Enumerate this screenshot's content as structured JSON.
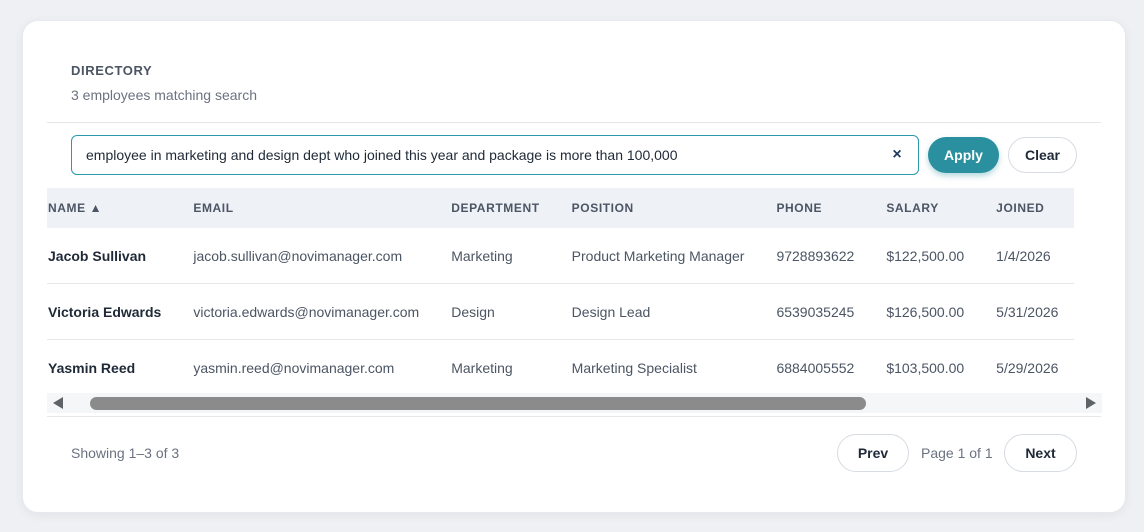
{
  "header": {
    "title": "DIRECTORY",
    "subtitle": "3 employees matching search"
  },
  "search": {
    "value": "employee in marketing and design dept who joined this year and package is more than 100,000",
    "clear_icon": "×",
    "apply_label": "Apply",
    "clear_label": "Clear"
  },
  "table": {
    "columns": [
      "NAME ▲",
      "EMAIL",
      "DEPARTMENT",
      "POSITION",
      "PHONE",
      "SALARY",
      "JOINED"
    ],
    "rows": [
      {
        "name": "Jacob Sullivan",
        "email": "jacob.sullivan@novimanager.com",
        "department": "Marketing",
        "position": "Product Marketing Manager",
        "phone": "9728893622",
        "salary": "$122,500.00",
        "joined": "1/4/2026"
      },
      {
        "name": "Victoria Edwards",
        "email": "victoria.edwards@novimanager.com",
        "department": "Design",
        "position": "Design Lead",
        "phone": "6539035245",
        "salary": "$126,500.00",
        "joined": "5/31/2026"
      },
      {
        "name": "Yasmin Reed",
        "email": "yasmin.reed@novimanager.com",
        "department": "Marketing",
        "position": "Marketing Specialist",
        "phone": "6884005552",
        "salary": "$103,500.00",
        "joined": "5/29/2026"
      }
    ]
  },
  "footer": {
    "showing": "Showing 1–3 of 3",
    "prev_label": "Prev",
    "page_info": "Page 1 of 1",
    "next_label": "Next"
  },
  "colors": {
    "accent": "#2a8f9e",
    "search_border": "#2a9aab"
  }
}
